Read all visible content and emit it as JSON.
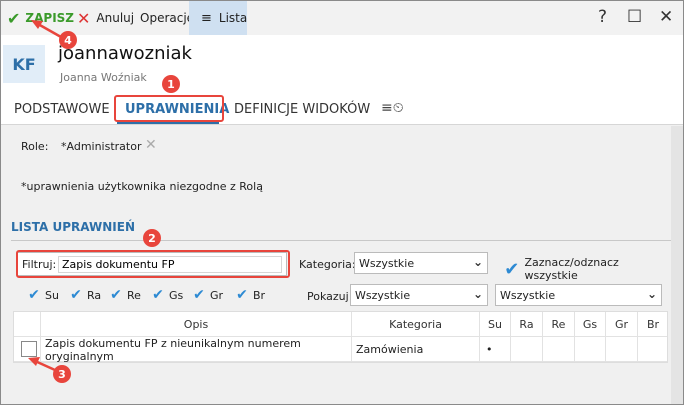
{
  "toolbar": {
    "save_label": "ZAPISZ",
    "cancel_label": "Anuluj",
    "operations_label": "Operacje",
    "list_label": "Lista",
    "help_glyph": "?",
    "maximize_glyph": "☐",
    "close_glyph": "✕"
  },
  "header": {
    "avatar_initials": "KF",
    "login": "joannawozniak",
    "full_name": "Joanna Woźniak"
  },
  "tabs": [
    {
      "label": "PODSTAWOWE",
      "active": false
    },
    {
      "label": "UPRAWNIENIA",
      "active": true
    },
    {
      "label": "DEFINICJE WIDOKÓW",
      "active": false
    }
  ],
  "roles": {
    "label": "Role:",
    "value": "*Administrator"
  },
  "note": "*uprawnienia użytkownika niezgodne z Rolą",
  "permissions": {
    "section_title": "LISTA UPRAWNIEŃ",
    "filter_label": "Filtruj:",
    "filter_value": "Zapis dokumentu FP",
    "category_label": "Kategoria:",
    "category_value": "Wszystkie",
    "select_all_label": "Zaznacz/odznacz wszystkie",
    "flags": [
      "Su",
      "Ra",
      "Re",
      "Gs",
      "Gr",
      "Br"
    ],
    "show_label": "Pokazuj:",
    "show_value_1": "Wszystkie",
    "show_value_2": "Wszystkie"
  },
  "table": {
    "columns": [
      "Opis",
      "Kategoria",
      "Su",
      "Ra",
      "Re",
      "Gs",
      "Gr",
      "Br"
    ],
    "rows": [
      {
        "opis": "Zapis dokumentu FP z nieunikalnym numerem oryginalnym",
        "kategoria": "Zamówienia",
        "su": "•",
        "ra": "",
        "re": "",
        "gs": "",
        "gr": "",
        "br": ""
      }
    ]
  },
  "annotations": [
    "1",
    "2",
    "3",
    "4"
  ],
  "colors": {
    "accent": "#2d6fa8",
    "save_green": "#3a9a2a",
    "cancel_red": "#dd3333",
    "annotation_red": "#e8453c",
    "check_blue": "#2d8ad3"
  }
}
